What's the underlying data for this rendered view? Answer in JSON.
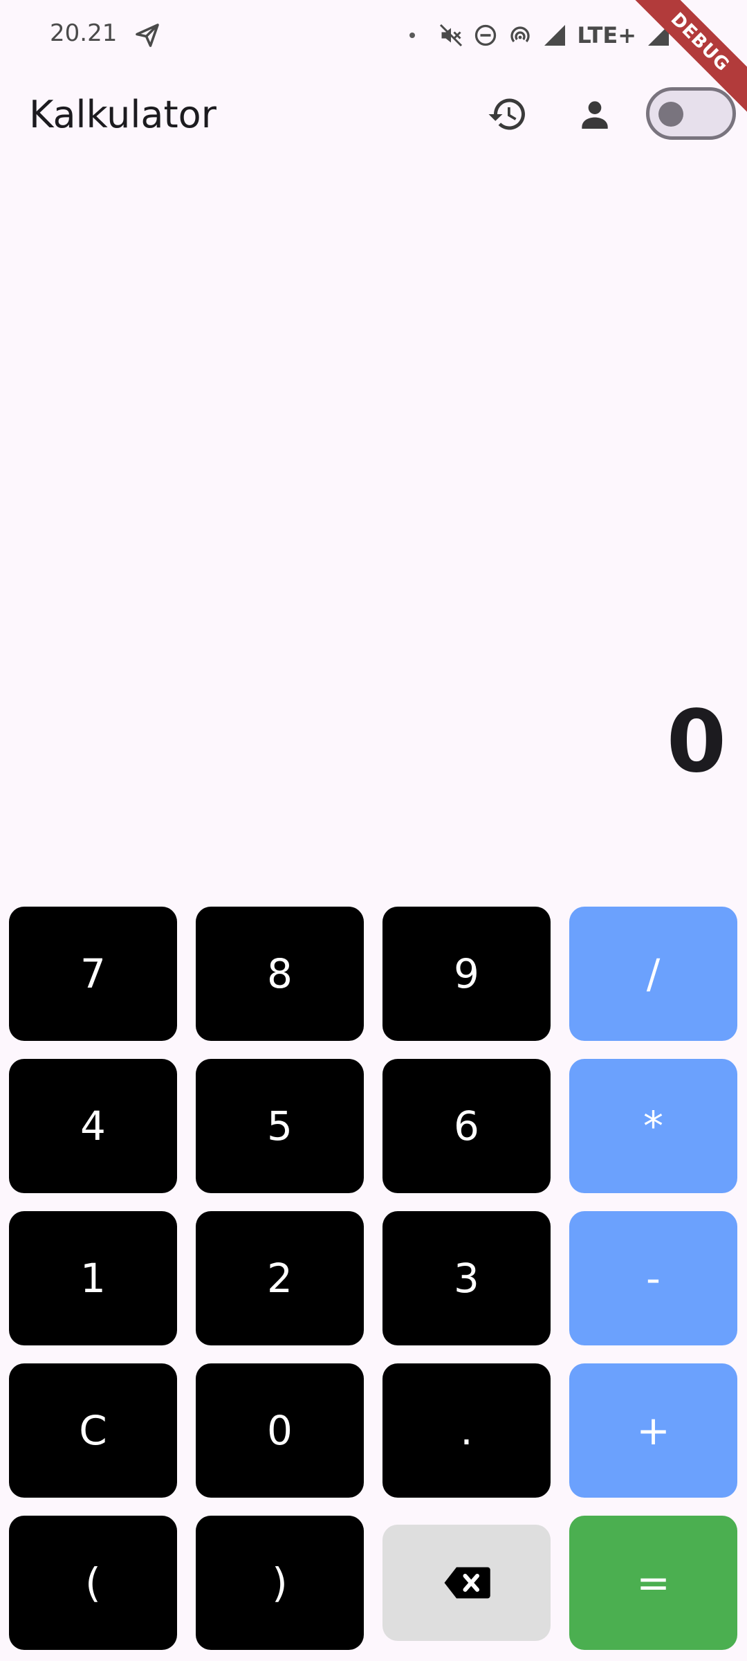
{
  "status_bar": {
    "time": "20.21",
    "network": "LTE+",
    "debug_label": "DEBUG"
  },
  "app_bar": {
    "title": "Kalkulator",
    "icons": [
      "history-icon",
      "person-icon"
    ],
    "theme_toggle_on": false
  },
  "display": {
    "value": "0"
  },
  "keypad": {
    "rows": [
      [
        "7",
        "8",
        "9",
        "/"
      ],
      [
        "4",
        "5",
        "6",
        "*"
      ],
      [
        "1",
        "2",
        "3",
        "-"
      ],
      [
        "C",
        "0",
        ".",
        "+"
      ],
      [
        "(",
        ")",
        "backspace-icon",
        "="
      ]
    ]
  },
  "colors": {
    "background": "#FDF7FD",
    "digit_key": "#000000",
    "operator_key": "#6BA1FD",
    "equals_key": "#4BAF50",
    "backspace_key": "#DEDEDE"
  }
}
